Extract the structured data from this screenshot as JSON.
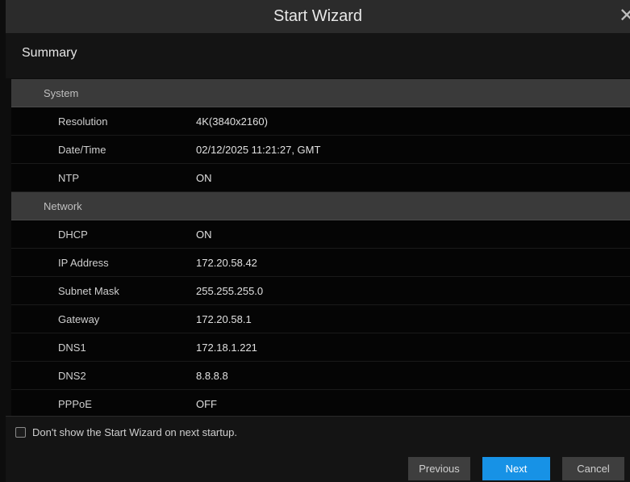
{
  "window": {
    "title": "Start Wizard"
  },
  "summary": {
    "label": "Summary"
  },
  "sections": [
    {
      "name": "System",
      "rows": [
        {
          "key": "Resolution",
          "value": "4K(3840x2160)"
        },
        {
          "key": "Date/Time",
          "value": "02/12/2025 11:21:27, GMT"
        },
        {
          "key": "NTP",
          "value": "ON"
        }
      ]
    },
    {
      "name": "Network",
      "rows": [
        {
          "key": "DHCP",
          "value": "ON"
        },
        {
          "key": "IP Address",
          "value": "172.20.58.42"
        },
        {
          "key": "Subnet Mask",
          "value": "255.255.255.0"
        },
        {
          "key": "Gateway",
          "value": "172.20.58.1"
        },
        {
          "key": "DNS1",
          "value": "172.18.1.221"
        },
        {
          "key": "DNS2",
          "value": "8.8.8.8"
        },
        {
          "key": "PPPoE",
          "value": "OFF"
        }
      ]
    }
  ],
  "footer": {
    "checkbox_label": "Don't show the Start Wizard on next startup.",
    "previous_label": "Previous",
    "next_label": "Next",
    "cancel_label": "Cancel"
  },
  "colors": {
    "accent": "#1792e6"
  }
}
